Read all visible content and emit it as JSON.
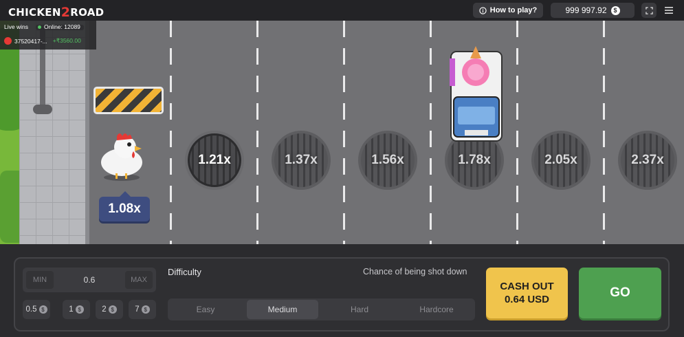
{
  "header": {
    "logo_text_a": "CHICKEN",
    "logo_text_two": "2",
    "logo_text_b": "ROAD",
    "how_to_play": "How to play?",
    "balance": "999 997.92",
    "currency_symbol": "$"
  },
  "live": {
    "live_wins_label": "Live wins",
    "online_label": "Online: 12089",
    "user": "37520417-...",
    "amount": "+₹3560.00"
  },
  "game": {
    "chicken_multiplier": "1.08x",
    "lanes": [
      "1.21x",
      "1.37x",
      "1.56x",
      "1.78x",
      "2.05x",
      "2.37x"
    ]
  },
  "controls": {
    "min_label": "MIN",
    "max_label": "MAX",
    "bet_value": "0.6",
    "quick_bets": [
      "0.5",
      "1",
      "2",
      "7"
    ],
    "difficulty_title": "Difficulty",
    "chance_label": "Chance of being shot down",
    "difficulties": [
      "Easy",
      "Medium",
      "Hard",
      "Hardcore"
    ],
    "selected_difficulty": "Medium",
    "cashout_line1": "CASH OUT",
    "cashout_line2": "0.64 USD",
    "go_label": "GO"
  },
  "colors": {
    "accent_yellow": "#f0c44c",
    "go_green": "#4ea050",
    "multiplier_blue": "#3e4d80",
    "live_green": "#53c162"
  }
}
